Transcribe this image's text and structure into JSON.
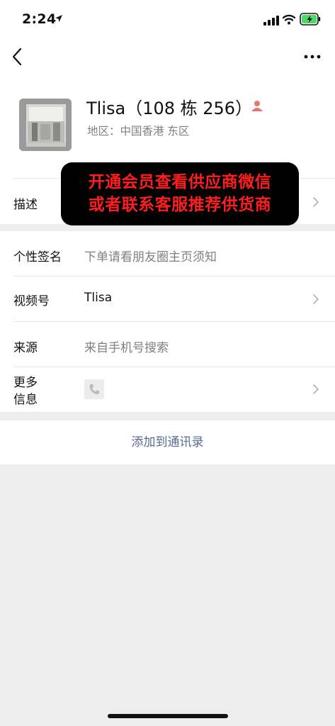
{
  "status_bar": {
    "time": "2:24"
  },
  "profile": {
    "name": "Tlisa（108 栋 256）",
    "region": "地区：中国香港 东区"
  },
  "rows": {
    "description_label": "描述",
    "signature_label": "个性签名",
    "signature_value": "下单请看朋友圈主页须知",
    "channels_label": "视频号",
    "channels_value": "Tlisa",
    "source_label": "来源",
    "source_value": "来自手机号搜索",
    "more_info_line1": "更多",
    "more_info_line2": "信息"
  },
  "actions": {
    "add_to_contacts": "添加到通讯录"
  },
  "promo": {
    "line1": "开通会员查看供应商微信",
    "line2": "或者联系客服推荐供货商"
  },
  "colors": {
    "accent_link": "#576b95",
    "promo_text": "#ff1d1d",
    "battery_green": "#4cd964",
    "person_icon": "#e8766b"
  }
}
